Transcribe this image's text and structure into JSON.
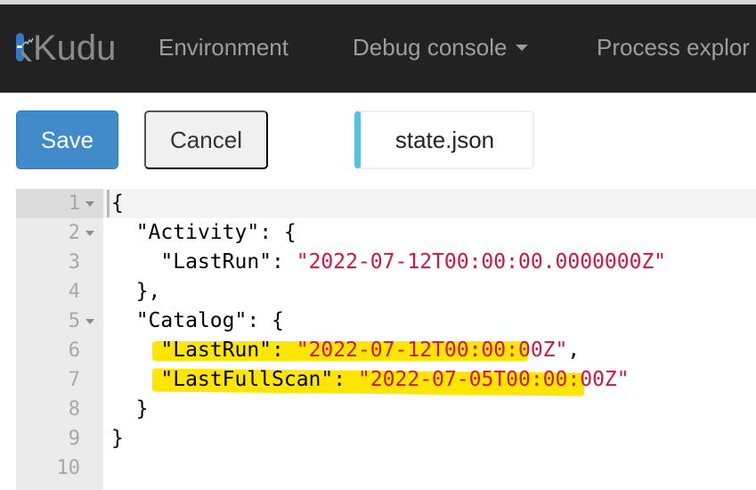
{
  "navbar": {
    "brand": "Kudu",
    "brand_icon": "kudu-knife-logo-icon",
    "items": [
      {
        "label": "Environment"
      },
      {
        "label": "Debug console",
        "has_dropdown": true
      },
      {
        "label": "Process explor"
      }
    ]
  },
  "toolbar": {
    "save_label": "Save",
    "cancel_label": "Cancel",
    "file_name": "state.json"
  },
  "colors": {
    "navbar_bg": "#222222",
    "save_button": "#428bca",
    "file_accent": "#5bc0de",
    "string_literal": "#d1163f",
    "highlight": "#ffe600"
  },
  "editor": {
    "active_line": 1,
    "lines": [
      {
        "number": "1",
        "foldable": true,
        "indent": "",
        "key": "",
        "sep": "",
        "value": "",
        "tail": "{"
      },
      {
        "number": "2",
        "foldable": true,
        "indent": "  ",
        "key": "\"Activity\"",
        "sep": ": ",
        "value": "",
        "tail": "{"
      },
      {
        "number": "3",
        "foldable": false,
        "indent": "    ",
        "key": "\"LastRun\"",
        "sep": ": ",
        "value": "\"2022-07-12T00:00:00.0000000Z\"",
        "tail": ""
      },
      {
        "number": "4",
        "foldable": false,
        "indent": "  ",
        "key": "",
        "sep": "",
        "value": "",
        "tail": "},"
      },
      {
        "number": "5",
        "foldable": true,
        "indent": "  ",
        "key": "\"Catalog\"",
        "sep": ": ",
        "value": "",
        "tail": "{"
      },
      {
        "number": "6",
        "foldable": false,
        "indent": "    ",
        "key": "\"LastRun\"",
        "sep": ": ",
        "value": "\"2022-07-12T00:00:00Z\"",
        "tail": ",",
        "highlighted": true
      },
      {
        "number": "7",
        "foldable": false,
        "indent": "    ",
        "key": "\"LastFullScan\"",
        "sep": ": ",
        "value": "\"2022-07-05T00:00:00Z\"",
        "tail": "",
        "highlighted": true
      },
      {
        "number": "8",
        "foldable": false,
        "indent": "  ",
        "key": "",
        "sep": "",
        "value": "",
        "tail": "}"
      },
      {
        "number": "9",
        "foldable": false,
        "indent": "",
        "key": "",
        "sep": "",
        "value": "",
        "tail": "}"
      },
      {
        "number": "10",
        "foldable": false,
        "indent": "",
        "key": "",
        "sep": "",
        "value": "",
        "tail": ""
      }
    ]
  }
}
